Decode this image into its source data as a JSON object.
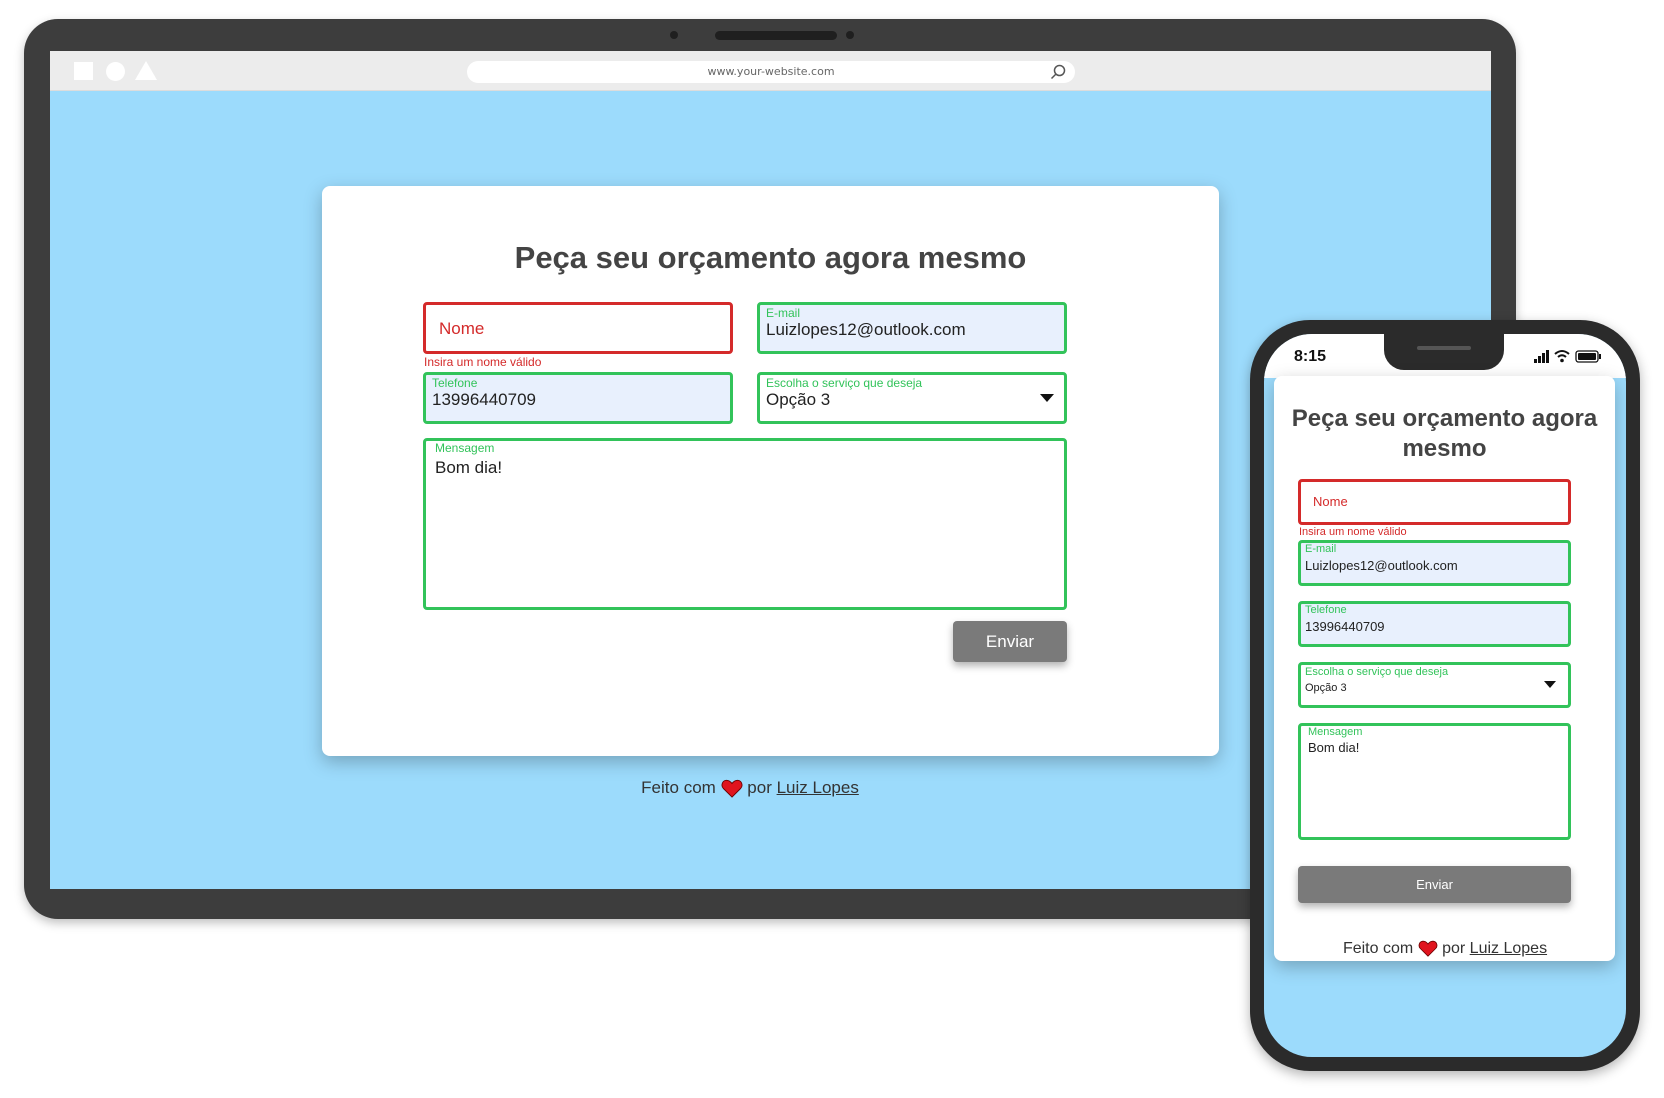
{
  "browser": {
    "url": "www.your-website.com"
  },
  "desktop": {
    "title": "Peça seu orçamento agora mesmo",
    "nome": {
      "placeholder": "Nome",
      "error": "Insira um nome válido"
    },
    "email": {
      "label": "E-mail",
      "value": "Luizlopes12@outlook.com"
    },
    "telefone": {
      "label": "Telefone",
      "value": "13996440709"
    },
    "servico": {
      "label": "Escolha o serviço que deseja",
      "value": "Opção 3"
    },
    "mensagem": {
      "label": "Mensagem",
      "value": "Bom dia!"
    },
    "submit_label": "Enviar",
    "footer": {
      "prefix": "Feito com",
      "middle": "por",
      "author": "Luiz Lopes"
    }
  },
  "mobile": {
    "time": "8:15",
    "title": "Peça seu orçamento agora mesmo",
    "nome": {
      "placeholder": "Nome",
      "error": "Insira um nome válido"
    },
    "email": {
      "label": "E-mail",
      "value": "Luizlopes12@outlook.com"
    },
    "telefone": {
      "label": "Telefone",
      "value": "13996440709"
    },
    "servico": {
      "label": "Escolha o serviço que deseja",
      "value": "Opção 3"
    },
    "mensagem": {
      "label": "Mensagem",
      "value": "Bom dia!"
    },
    "submit_label": "Enviar",
    "footer": {
      "prefix": "Feito com",
      "middle": "por",
      "author": "Luiz Lopes"
    }
  },
  "colors": {
    "background": "#9cdbfc",
    "valid": "#32c35a",
    "error": "#d42a2a",
    "button": "#7a7a7a",
    "heart": "#e0141e"
  },
  "icons": [
    "search-icon",
    "chevron-down-icon",
    "heart-icon",
    "signal-icon",
    "wifi-icon",
    "battery-icon"
  ]
}
